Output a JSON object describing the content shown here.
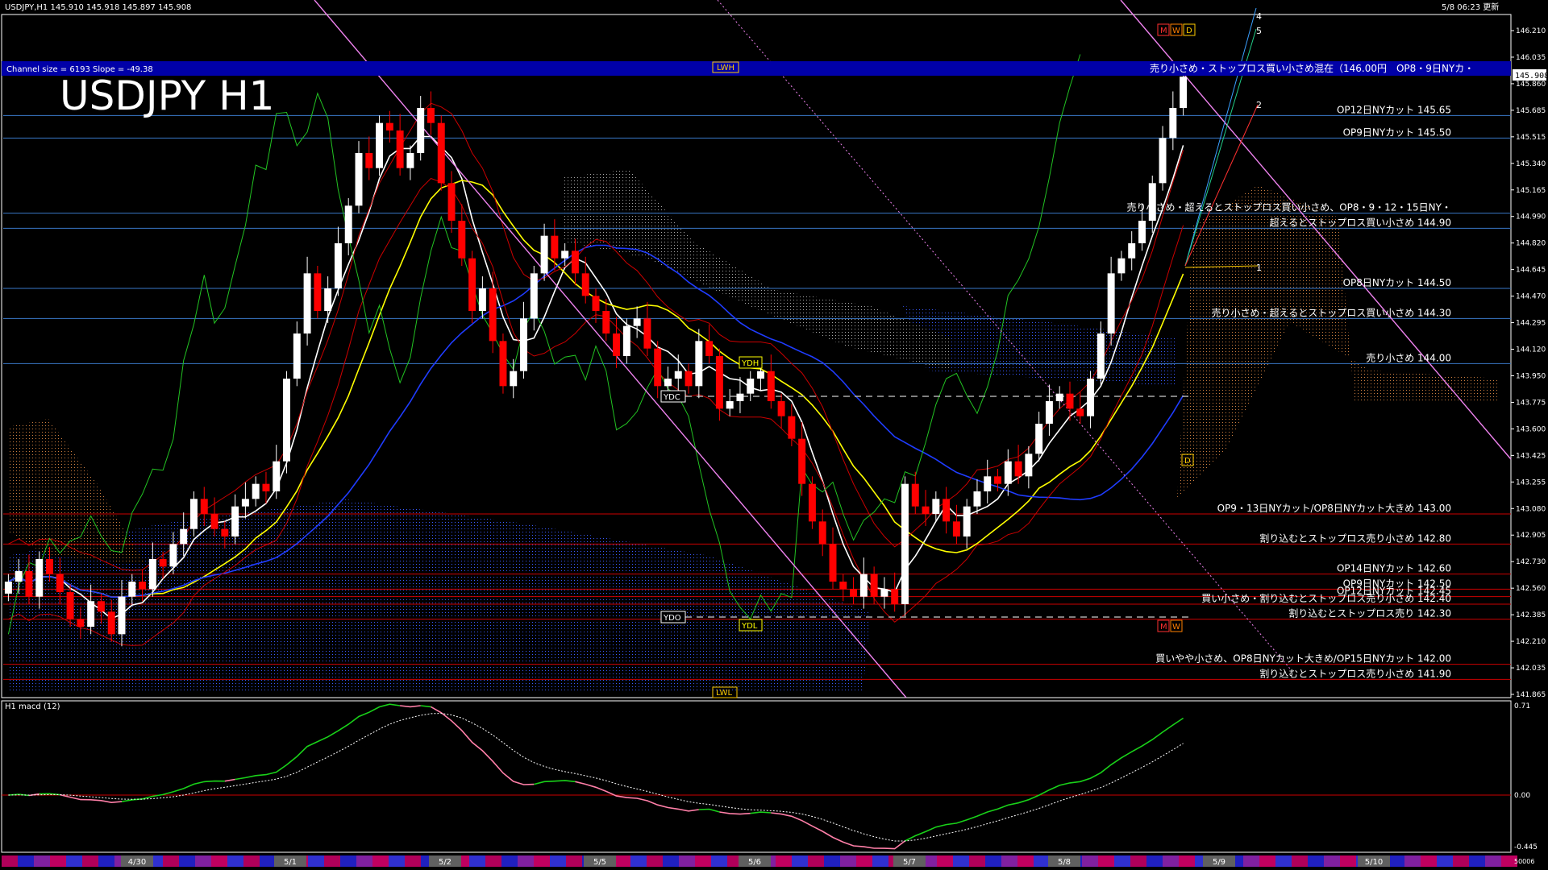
{
  "header": {
    "symbol_info": "USDJPY,H1  145.910 145.918 145.897 145.908",
    "datetime": "5/8 06:23 更新",
    "channel_info": "Channel size = 6193 Slope = -49.38",
    "big_title": "USDJPY H1"
  },
  "colors": {
    "background": "#000000",
    "axis": "#ffffff",
    "level_blue": "#3a78c8",
    "level_red": "#cc0000",
    "candle_up": "#ffffff",
    "candle_down": "#ff0000",
    "sma_white": "#ffffff",
    "sma_yellow": "#ffff00",
    "sma_blue": "#1f3cff",
    "line_green": "#22c322",
    "channel_violet": "#ee82ee",
    "banner_bg": "#0000a8",
    "macd_green": "#19d119",
    "macd_pink": "#ff7fa8"
  },
  "banner": {
    "text": "売り小さめ・ストップロス買い小さめ混在（146.00円　OP8・9日NYカ・",
    "price_tag": "145.908"
  },
  "y_axis": {
    "labels": [
      "146.210",
      "146.035",
      "145.860",
      "145.685",
      "145.515",
      "145.340",
      "145.165",
      "144.990",
      "144.820",
      "144.645",
      "144.470",
      "144.295",
      "144.120",
      "143.950",
      "143.775",
      "143.600",
      "143.425",
      "143.255",
      "143.080",
      "142.905",
      "142.730",
      "142.560",
      "142.385",
      "142.210",
      "142.035",
      "141.865"
    ]
  },
  "levels": [
    {
      "price": 145.65,
      "color": "blue",
      "text": "OP12日NYカット 145.65"
    },
    {
      "price": 145.5,
      "color": "blue",
      "text": "OP9日NYカット 145.50"
    },
    {
      "price": 145.0,
      "color": "blue",
      "text": "売り小さめ・超えるとストップロス買い小さめ、OP8・9・12・15日NY・"
    },
    {
      "price": 144.9,
      "color": "blue",
      "text": "超えるとストップロス買い小さめ 144.90"
    },
    {
      "price": 144.5,
      "color": "blue",
      "text": "OP8日NYカット 144.50"
    },
    {
      "price": 144.3,
      "color": "blue",
      "text": "売り小さめ・超えるとストップロス買い小さめ 144.30"
    },
    {
      "price": 144.0,
      "color": "blue",
      "text": "売り小さめ 144.00"
    },
    {
      "price": 143.0,
      "color": "red",
      "text": "OP9・13日NYカット/OP8日NYカット大きめ 143.00"
    },
    {
      "price": 142.8,
      "color": "red",
      "text": "割り込むとストップロス売り小さめ 142.80"
    },
    {
      "price": 142.6,
      "color": "red",
      "text": "OP14日NYカット 142.60"
    },
    {
      "price": 142.5,
      "color": "red",
      "text": "OP9日NYカット 142.50"
    },
    {
      "price": 142.45,
      "color": "red",
      "text": "OP12日NYカット 142.45"
    },
    {
      "price": 142.4,
      "color": "red",
      "text": "買い小さめ・割り込むとストップロス売り小さめ 142.40"
    },
    {
      "price": 142.3,
      "color": "red",
      "text": "割り込むとストップロス売り 142.30"
    },
    {
      "price": 142.0,
      "color": "red",
      "text": "買いやや小さめ、OP8日NYカット大きめ/OP15日NYカット 142.00"
    },
    {
      "price": 141.9,
      "color": "red",
      "text": "割り込むとストップロス売り小さめ 141.90"
    }
  ],
  "markers": {
    "lwh": "LWH",
    "lwl": "LWL",
    "ydh": "YDH",
    "ydc": "YDC",
    "ydo": "YDO",
    "ydl": "YDL",
    "mwd_top": [
      "M",
      "W",
      "D"
    ],
    "mw_bottom": [
      "M",
      "W"
    ],
    "d_mid": "D",
    "numbers": [
      "4",
      "5",
      "2",
      "1"
    ]
  },
  "macd": {
    "label": "H1 macd (12)",
    "axis_labels": [
      "0.71",
      "0.00",
      "-0.445"
    ]
  },
  "x_axis": {
    "dates": [
      "4/30",
      "5/1",
      "5/2",
      "5/5",
      "5/6",
      "5/7",
      "5/8",
      "5/9",
      "5/10"
    ],
    "corner": "50006"
  },
  "chart_data": {
    "type": "candlestick",
    "title": "USDJPY H1",
    "symbol": "USDJPY",
    "timeframe": "H1",
    "last_price": 145.908,
    "ylim": [
      141.8,
      146.3
    ],
    "closes": [
      142.55,
      142.62,
      142.45,
      142.7,
      142.6,
      142.48,
      142.3,
      142.25,
      142.42,
      142.35,
      142.2,
      142.45,
      142.55,
      142.5,
      142.7,
      142.65,
      142.8,
      142.9,
      143.1,
      143.0,
      142.9,
      142.85,
      143.05,
      143.1,
      143.2,
      143.15,
      143.35,
      143.9,
      144.2,
      144.6,
      144.35,
      144.5,
      144.8,
      145.05,
      145.4,
      145.3,
      145.6,
      145.55,
      145.3,
      145.4,
      145.7,
      145.6,
      145.2,
      144.95,
      144.7,
      144.35,
      144.5,
      144.15,
      143.85,
      143.95,
      144.3,
      144.6,
      144.85,
      144.7,
      144.75,
      144.6,
      144.45,
      144.35,
      144.2,
      144.05,
      144.25,
      144.3,
      144.1,
      143.85,
      143.9,
      143.95,
      143.85,
      144.15,
      144.05,
      143.7,
      143.75,
      143.8,
      143.9,
      143.95,
      143.75,
      143.65,
      143.5,
      143.2,
      142.95,
      142.8,
      142.55,
      142.5,
      142.45,
      142.6,
      142.45,
      142.5,
      142.4,
      143.2,
      143.05,
      143.0,
      143.1,
      142.95,
      142.85,
      143.05,
      143.15,
      143.25,
      143.2,
      143.35,
      143.25,
      143.4,
      143.6,
      143.75,
      143.8,
      143.7,
      143.65,
      143.9,
      144.2,
      144.6,
      144.7,
      144.8,
      144.95,
      145.2,
      145.5,
      145.7,
      145.908
    ]
  }
}
